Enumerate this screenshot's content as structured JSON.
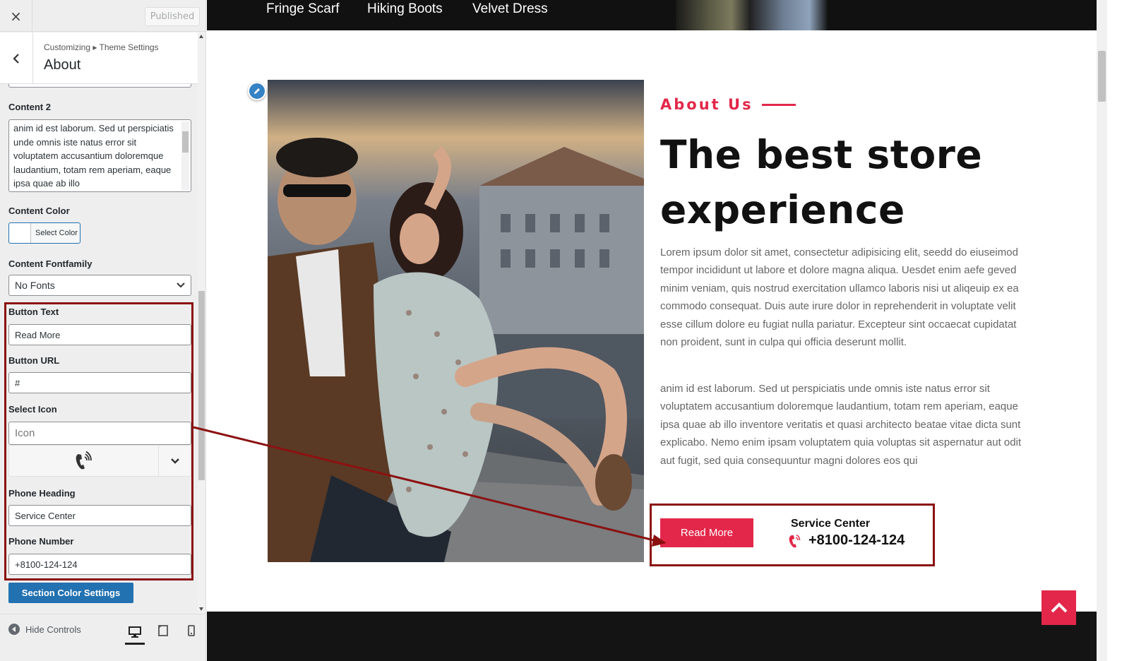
{
  "sidebar": {
    "close_label": "×",
    "published_label": "Published",
    "breadcrumb": "Customizing ▸ Theme Settings",
    "section_title": "About",
    "controls": {
      "content2_label": "Content 2",
      "content2_value": "anim id est laborum. Sed ut perspiciatis unde omnis iste natus error sit voluptatem accusantium doloremque laudantium, totam rem aperiam, eaque ipsa quae ab illo",
      "content_color_label": "Content Color",
      "select_color_label": "Select Color",
      "content_fontfamily_label": "Content Fontfamily",
      "content_fontfamily_value": "No Fonts",
      "button_text_label": "Button Text",
      "button_text_value": "Read More",
      "button_url_label": "Button URL",
      "button_url_value": "#",
      "select_icon_label": "Select Icon",
      "select_icon_placeholder": "Icon",
      "selected_icon": "phone-volume-icon",
      "phone_heading_label": "Phone Heading",
      "phone_heading_value": "Service Center",
      "phone_number_label": "Phone Number",
      "phone_number_value": "+8100-124-124",
      "section_color_button": "Section Color Settings"
    },
    "footer": {
      "hide_controls_label": "Hide Controls",
      "active_device": "desktop"
    }
  },
  "preview": {
    "nav_items": [
      "Fringe Scarf",
      "Hiking Boots",
      "Velvet Dress"
    ],
    "about": {
      "eyebrow": "About Us",
      "heading": "The best store experience",
      "paragraph_1": "Lorem ipsum dolor sit amet, consectetur adipisicing elit, seedd do eiuseimod tempor incididunt ut labore et dolore magna aliqua. Uesdet enim aefe geved minim veniam, quis nostrud exercitation ullamco laboris nisi ut aliqeuip ex ea commodo consequat. Duis aute irure dolor in reprehenderit in voluptate velit esse cillum dolore eu fugiat nulla pariatur. Excepteur sint occaecat cupidatat non proident, sunt in culpa qui officia deserunt mollit.",
      "paragraph_2": "anim id est laborum. Sed ut perspiciatis unde omnis iste natus error sit voluptatem accusantium doloremque laudantium, totam rem aperiam, eaque ipsa quae ab illo inventore veritatis et quasi architecto beatae vitae dicta sunt explicabo. Nemo enim ipsam voluptatem quia voluptas sit aspernatur aut odit aut fugit, sed quia consequuntur magni dolores eos qui",
      "button_label": "Read More",
      "phone_heading": "Service Center",
      "phone_number": "+8100-124-124"
    }
  },
  "colors": {
    "accent": "#e3274a",
    "admin_blue": "#2271b1",
    "annotation_red": "#8b1111",
    "nav_bg": "#111111"
  }
}
